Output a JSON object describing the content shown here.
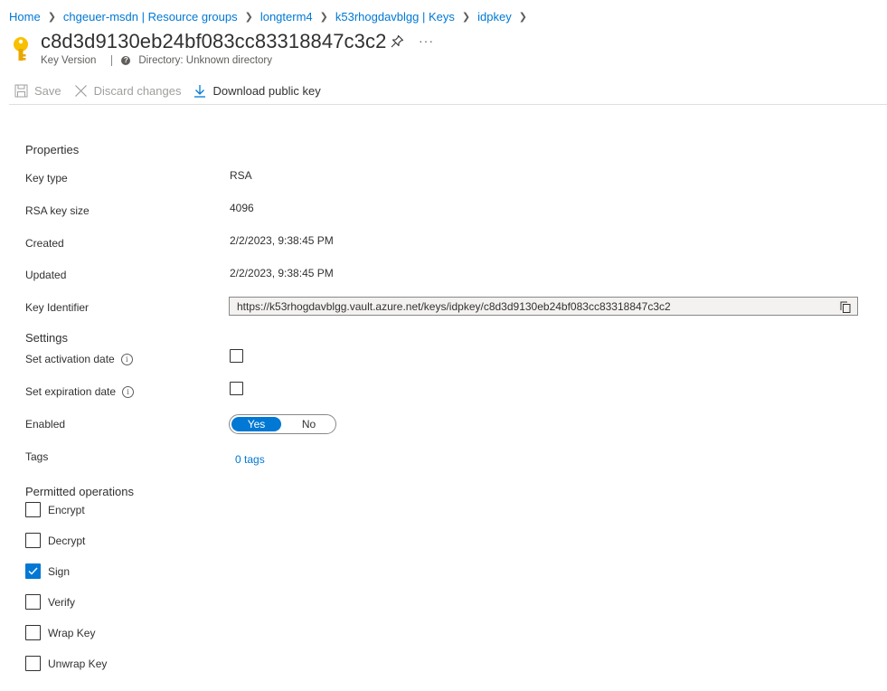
{
  "breadcrumb": {
    "items": [
      "Home",
      "chgeuer-msdn | Resource groups",
      "longterm4",
      "k53rhogdavblgg | Keys",
      "idpkey"
    ]
  },
  "header": {
    "title": "c8d3d9130eb24bf083cc83318847c3c2",
    "subtitle_type": "Key Version",
    "directory": "Directory: Unknown directory",
    "more_label": "···"
  },
  "toolbar": {
    "save_label": "Save",
    "discard_label": "Discard changes",
    "download_label": "Download public key"
  },
  "properties": {
    "section_title": "Properties",
    "key_type_label": "Key type",
    "key_type_value": "RSA",
    "key_size_label": "RSA key size",
    "key_size_value": "4096",
    "created_label": "Created",
    "created_value": "2/2/2023, 9:38:45 PM",
    "updated_label": "Updated",
    "updated_value": "2/2/2023, 9:38:45 PM",
    "key_identifier_label": "Key Identifier",
    "key_identifier_value": "https://k53rhogdavblgg.vault.azure.net/keys/idpkey/c8d3d9130eb24bf083cc83318847c3c2"
  },
  "settings": {
    "section_title": "Settings",
    "activation_label": "Set activation date",
    "activation_checked": false,
    "expiration_label": "Set expiration date",
    "expiration_checked": false,
    "enabled_label": "Enabled",
    "enabled_yes": "Yes",
    "enabled_no": "No",
    "enabled_value": "Yes",
    "tags_label": "Tags",
    "tags_value": "0 tags",
    "info_glyph": "i"
  },
  "permitted_operations": {
    "section_title": "Permitted operations",
    "items": [
      {
        "label": "Encrypt",
        "checked": false
      },
      {
        "label": "Decrypt",
        "checked": false
      },
      {
        "label": "Sign",
        "checked": true
      },
      {
        "label": "Verify",
        "checked": false
      },
      {
        "label": "Wrap Key",
        "checked": false
      },
      {
        "label": "Unwrap Key",
        "checked": false
      }
    ]
  },
  "colors": {
    "accent": "#0078d4",
    "key_icon": "#f8c100",
    "text": "#323130",
    "disabled": "#a19f9d"
  },
  "icons": {
    "key": "key-icon",
    "pin": "pin-icon",
    "more": "more-icon",
    "save": "save-icon",
    "discard": "close-icon",
    "download": "download-icon",
    "copy": "copy-icon",
    "info": "info-icon",
    "checkmark": "checkmark-icon"
  }
}
